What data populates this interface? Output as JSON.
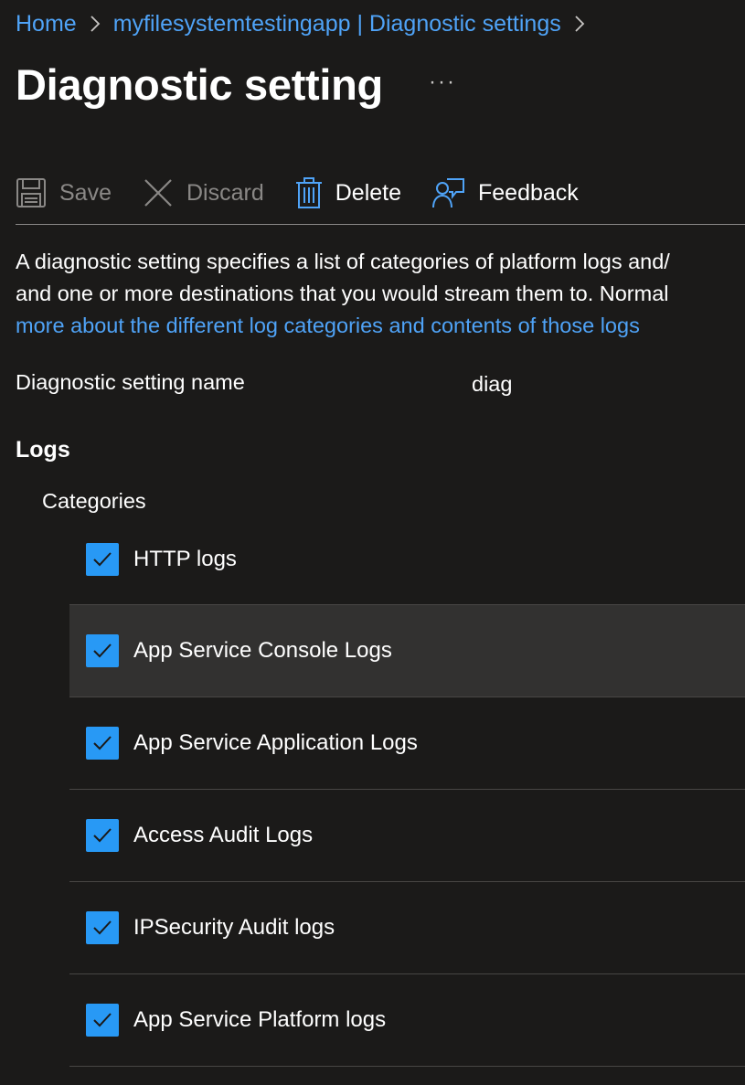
{
  "breadcrumb": {
    "items": [
      {
        "label": "Home"
      },
      {
        "label": "myfilesystemtestingapp | Diagnostic settings"
      }
    ]
  },
  "header": {
    "title": "Diagnostic setting",
    "more_label": "···"
  },
  "toolbar": {
    "save_label": "Save",
    "discard_label": "Discard",
    "delete_label": "Delete",
    "feedback_label": "Feedback"
  },
  "description": {
    "line1": "A diagnostic setting specifies a list of categories of platform logs and/",
    "line2": "and one or more destinations that you would stream them to. Normal",
    "link_text": "more about the different log categories and contents of those logs"
  },
  "setting": {
    "name_label": "Diagnostic setting name",
    "name_value": "diag"
  },
  "logs": {
    "heading": "Logs",
    "categories_heading": "Categories",
    "categories": [
      {
        "label": "HTTP logs",
        "checked": true
      },
      {
        "label": "App Service Console Logs",
        "checked": true
      },
      {
        "label": "App Service Application Logs",
        "checked": true
      },
      {
        "label": "Access Audit Logs",
        "checked": true
      },
      {
        "label": "IPSecurity Audit logs",
        "checked": true
      },
      {
        "label": "App Service Platform logs",
        "checked": true
      }
    ]
  },
  "colors": {
    "background": "#1b1a19",
    "link": "#4fa3f7",
    "checkbox": "#2899f5",
    "hover_row": "#323130",
    "disabled_text": "#8a8886"
  },
  "icons": {
    "save": "save-icon",
    "discard": "close-icon",
    "delete": "trash-icon",
    "feedback": "feedback-icon",
    "breadcrumb_separator": "chevron-right-icon",
    "checkbox": "checkmark-icon"
  }
}
